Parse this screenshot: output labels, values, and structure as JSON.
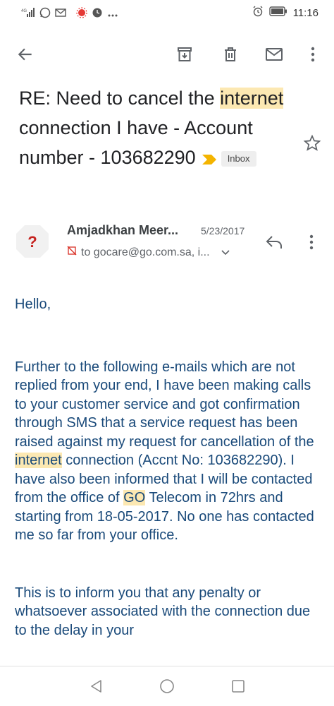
{
  "status_bar": {
    "time": "11:16",
    "left_icons": [
      "signal-icon",
      "whatsapp-icon",
      "mail-notification-icon",
      "app-icon",
      "alarm-clock-icon",
      "more-dots-icon"
    ],
    "right_icons": [
      "alarm-icon",
      "battery-icon"
    ]
  },
  "toolbar": {
    "actions": [
      "back",
      "archive",
      "delete",
      "mark-unread",
      "more"
    ]
  },
  "email": {
    "subject_part1": "RE: Need to cancel the ",
    "subject_highlight": "internet",
    "subject_part2": " connection I have - Account number - 103682290",
    "label": "Inbox",
    "sender_name": "Amjadkhan Meer...",
    "sender_initial": "?",
    "date": "5/23/2017",
    "recipient": "to gocare@go.com.sa, i...",
    "greeting": "Hello,",
    "p1_a": "Further to the following e-mails which are not replied from your end, I have been making calls to your customer service and got confirmation through SMS that a service request has been raised against my request for cancellation of the ",
    "p1_hl1": "internet",
    "p1_b": " connection (Accnt No: 103682290). I have also been informed that I will be contacted from the office of ",
    "p1_hl2": "GO",
    "p1_c": " Telecom in 72hrs and starting from 18-05-2017. No one has contacted me so far from your office.",
    "p2": "This is to inform you that any penalty or whatsoever associated with the connection due to the delay in your"
  },
  "colors": {
    "highlight": "#fce8b2",
    "body_text": "#1a4a7a",
    "importance": "#f4b400",
    "avatar_question": "#c5221f"
  }
}
